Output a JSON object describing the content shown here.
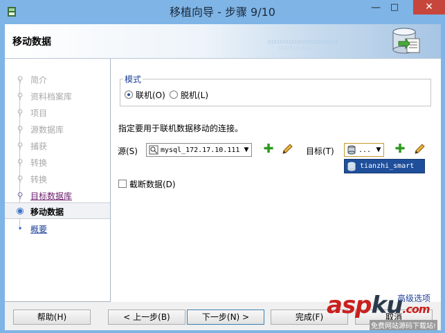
{
  "window": {
    "title": "移植向导 - 步骤 9/10",
    "minimize": "—",
    "maximize": "□",
    "close": "✕"
  },
  "header": {
    "title": "移动数据",
    "binary_line1": "010101010101010101010101",
    "binary_line2": "0101010101010101"
  },
  "nav": {
    "items": [
      {
        "label": "简介",
        "state": "disabled"
      },
      {
        "label": "资料档案库",
        "state": "disabled"
      },
      {
        "label": "项目",
        "state": "disabled"
      },
      {
        "label": "源数据库",
        "state": "disabled"
      },
      {
        "label": "捕获",
        "state": "disabled"
      },
      {
        "label": "转换",
        "state": "disabled"
      },
      {
        "label": "转换",
        "state": "disabled"
      },
      {
        "label": "目标数据库",
        "state": "done"
      },
      {
        "label": "移动数据",
        "state": "current"
      },
      {
        "label": "概要",
        "state": "next"
      }
    ]
  },
  "mode": {
    "legend": "模式",
    "online_label": "联机(O)",
    "offline_label": "脱机(L)",
    "selected": "online"
  },
  "description": "指定要用于联机数据移动的连接。",
  "source": {
    "label": "源(S)",
    "value": "mysql_172.17.10.111"
  },
  "target": {
    "label": "目标(T)",
    "value": "...",
    "dropdown_option": "tianzhi_smart"
  },
  "truncate": {
    "label": "截断数据(D)",
    "checked": false
  },
  "advanced_link": "高级选项",
  "buttons": {
    "help": "帮助(H)",
    "back": "< 上一步(B)",
    "next": "下一步(N) >",
    "finish": "完成(F)",
    "cancel": "取消"
  },
  "watermark": {
    "main_a": "asp",
    "main_b": "ku",
    "suffix": ".com",
    "sub": "免费网站源码下载站!"
  },
  "colors": {
    "titlebar": "#7fb4e6",
    "close": "#c7463b",
    "link": "#1c3f96",
    "add_green": "#2d9a1f",
    "selected_option": "#1f4f9b"
  }
}
